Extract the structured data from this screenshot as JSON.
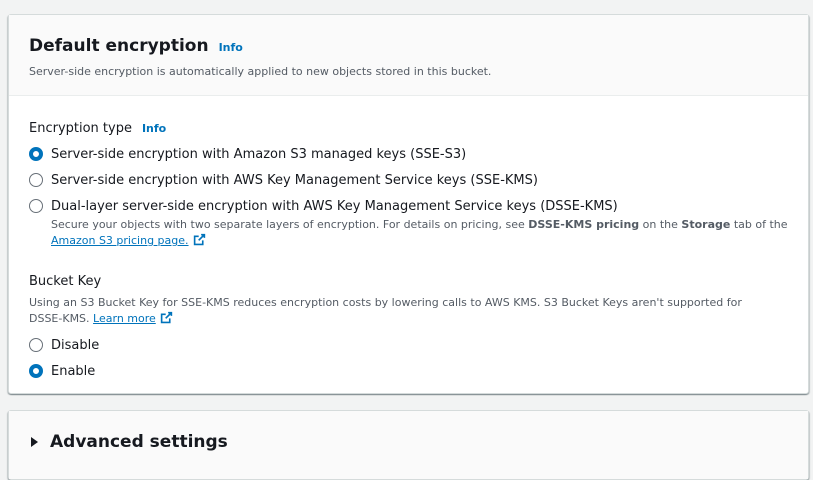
{
  "default_encryption": {
    "title": "Default encryption",
    "info_label": "Info",
    "description": "Server-side encryption is automatically applied to new objects stored in this bucket."
  },
  "encryption_type": {
    "label": "Encryption type",
    "info_label": "Info",
    "selected": "sse-s3",
    "options": [
      {
        "id": "sse-s3",
        "label": "Server-side encryption with Amazon S3 managed keys (SSE-S3)",
        "checked": true
      },
      {
        "id": "sse-kms",
        "label": "Server-side encryption with AWS Key Management Service keys (SSE-KMS)",
        "checked": false
      },
      {
        "id": "dsse-kms",
        "label": "Dual-layer server-side encryption with AWS Key Management Service keys (DSSE-KMS)",
        "checked": false
      }
    ],
    "dsse_desc": {
      "prefix": "Secure your objects with two separate layers of encryption. For details on pricing, see ",
      "bold1": "DSSE-KMS pricing",
      "mid": " on the ",
      "bold2": "Storage",
      "suffix": " tab of the",
      "link": "Amazon S3 pricing page."
    }
  },
  "bucket_key": {
    "label": "Bucket Key",
    "description": "Using an S3 Bucket Key for SSE-KMS reduces encryption costs by lowering calls to AWS KMS. S3 Bucket Keys aren't supported for DSSE-KMS.",
    "learn_more": "Learn more",
    "options": [
      {
        "id": "disable",
        "label": "Disable",
        "checked": false
      },
      {
        "id": "enable",
        "label": "Enable",
        "checked": true
      }
    ]
  },
  "advanced_settings": {
    "title": "Advanced settings",
    "expanded": false
  },
  "colors": {
    "link": "#0073bb",
    "radio_selected": "#0073bb",
    "text": "#16191f",
    "secondary_text": "#545b64",
    "background": "#f2f3f3"
  },
  "icons": {
    "external_link": "external-link-icon",
    "caret": "caret-right-icon"
  }
}
